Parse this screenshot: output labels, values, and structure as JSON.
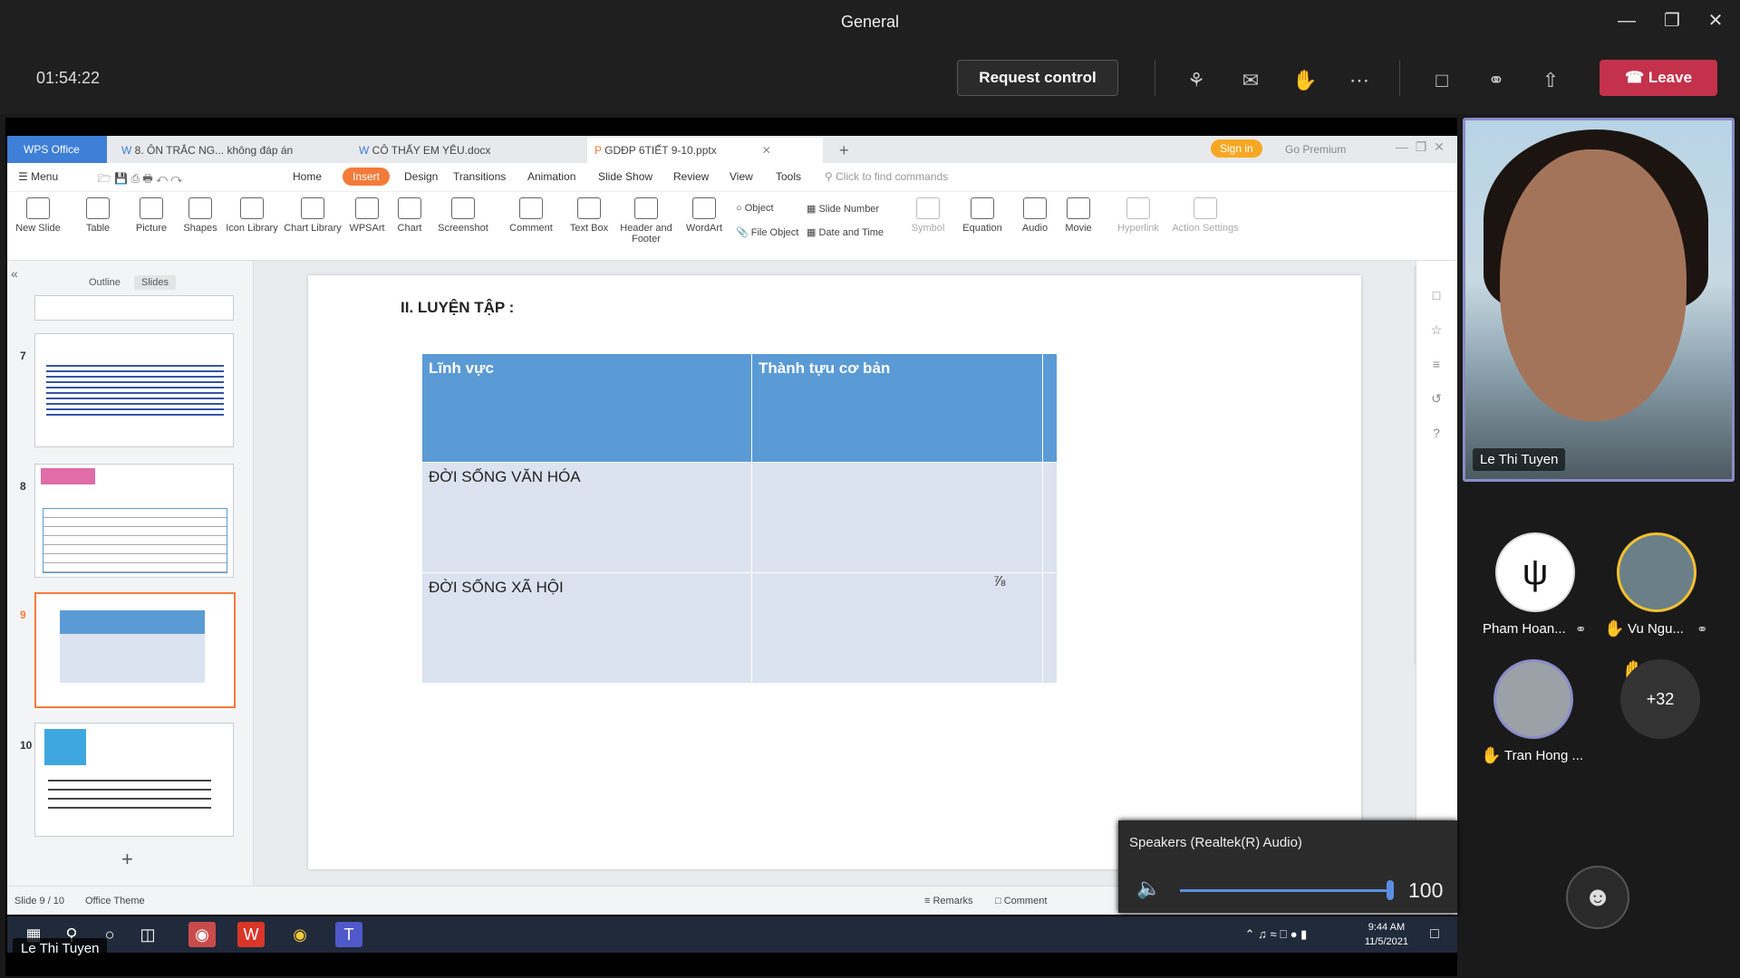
{
  "window": {
    "title": "General"
  },
  "meeting": {
    "timer": "01:54:22",
    "request_control": "Request control",
    "leave": "Leave"
  },
  "wps": {
    "tabs": [
      {
        "label": "WPS Office"
      },
      {
        "label": "8. ÔN TRẮC NG... không đáp án"
      },
      {
        "label": "CÔ THẤY EM YÊU.docx"
      },
      {
        "label": "GDĐP 6TIẾT 9-10.pptx"
      }
    ],
    "sign_in": "Sign in",
    "go_premium": "Go Premium",
    "menu": {
      "menu_label": "Menu",
      "items": [
        "Home",
        "Insert",
        "Design",
        "Transitions",
        "Animation",
        "Slide Show",
        "Review",
        "View",
        "Tools"
      ],
      "search_placeholder": "Click to find commands"
    },
    "ribbon": {
      "new_slide": "New Slide",
      "table": "Table",
      "picture": "Picture",
      "shapes": "Shapes",
      "icon_library": "Icon Library",
      "chart_library": "Chart Library",
      "wpsart": "WPSArt",
      "chart": "Chart",
      "screenshot": "Screenshot",
      "comment": "Comment",
      "text_box": "Text Box",
      "header_footer": "Header and Footer",
      "wordart": "WordArt",
      "object": "Object",
      "file_object": "File Object",
      "slide_number": "Slide Number",
      "date_time": "Date and Time",
      "symbol": "Symbol",
      "equation": "Equation",
      "audio": "Audio",
      "movie": "Movie",
      "hyperlink": "Hyperlink",
      "action_settings": "Action Settings"
    },
    "panel": {
      "outline": "Outline",
      "slides": "Slides",
      "thumb_numbers": [
        "7",
        "8",
        "9",
        "10"
      ],
      "add_slide": "+"
    },
    "slide": {
      "title": "II. LUYỆN TẬP :",
      "header": [
        "Lĩnh vực",
        "Thành tựu cơ bản"
      ],
      "rows": [
        "ĐỜI SỐNG VĂN HÓA",
        "ĐỜI SỐNG XÃ HỘI"
      ]
    },
    "status": {
      "slide_count": "Slide 9 / 10",
      "theme": "Office Theme",
      "remarks": "Remarks",
      "comment": "Comment"
    }
  },
  "speakers": {
    "label": "Speakers (Realtek(R) Audio)",
    "volume": "100"
  },
  "taskbar": {
    "time": "9:44 AM",
    "date": "11/5/2021"
  },
  "sharer_name": "Le Thi Tuyen",
  "participants": {
    "main": "Le Thi Tuyen",
    "tiles": [
      {
        "name": "Pham Hoan..."
      },
      {
        "name": "Vu Ngu..."
      },
      {
        "name": "Tran Hong ..."
      },
      {
        "name": "+32"
      }
    ]
  },
  "colors": {
    "leave": "#c4314b",
    "insert_tab": "#f47b3a",
    "table_header": "#5b9bd5",
    "table_body": "#dbe3f0"
  }
}
